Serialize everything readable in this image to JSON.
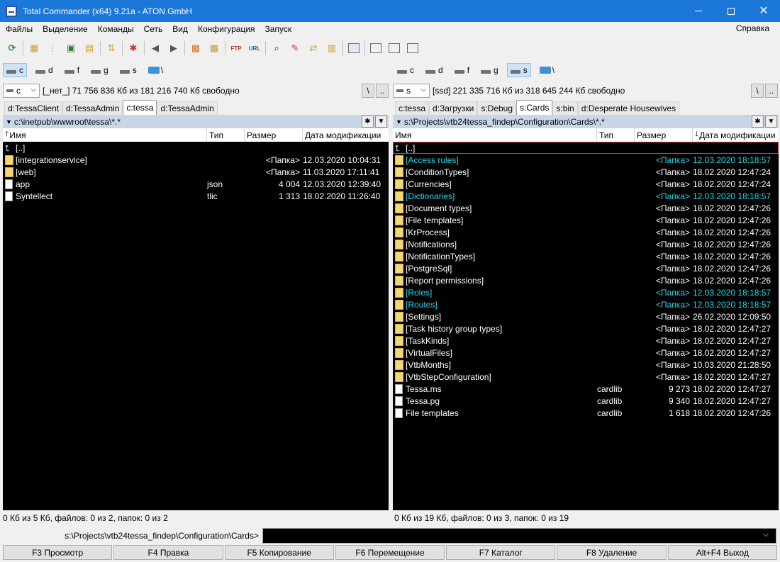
{
  "window": {
    "title": "Total Commander (x64) 9.21a - ATON GmbH"
  },
  "menu": {
    "items": [
      "Файлы",
      "Выделение",
      "Команды",
      "Сеть",
      "Вид",
      "Конфигурация",
      "Запуск"
    ],
    "help": "Справка"
  },
  "left": {
    "drives": [
      "c",
      "d",
      "f",
      "g",
      "s",
      "\\"
    ],
    "active_drive": "c",
    "drive_combo": "c",
    "drive_info": "[_нет_]  71 756 836 Кб из 181 216 740 Кб свободно",
    "root_btn": "\\",
    "up_btn": "..",
    "tabs": [
      "d:TessaClient",
      "d:TessaAdmin",
      "c:tessa",
      "d:TessaAdmin"
    ],
    "active_tab": 2,
    "path": "c:\\inetpub\\wwwroot\\tessa\\*.*",
    "cols": {
      "name": "Имя",
      "ext": "Тип",
      "size": "Размер",
      "date": "Дата модификации"
    },
    "rows": [
      {
        "name": "[..]",
        "ext": "",
        "size": "",
        "date": "",
        "kind": "up"
      },
      {
        "name": "[integrationservice]",
        "ext": "",
        "size": "<Папка>",
        "date": "12.03.2020 10:04:31",
        "kind": "folder"
      },
      {
        "name": "[web]",
        "ext": "",
        "size": "<Папка>",
        "date": "11.03.2020 17:11:41",
        "kind": "folder"
      },
      {
        "name": "app",
        "ext": "json",
        "size": "4 004",
        "date": "12.03.2020 12:39:40",
        "kind": "file"
      },
      {
        "name": "Syntellect",
        "ext": "tlic",
        "size": "1 313",
        "date": "18.02.2020 11:26:40",
        "kind": "file"
      }
    ],
    "status": "0 Кб из 5 Кб, файлов: 0 из 2, папок: 0 из 2"
  },
  "right": {
    "drives": [
      "c",
      "d",
      "f",
      "g",
      "s",
      "\\"
    ],
    "active_drive": "s",
    "drive_combo": "s",
    "drive_info": "[ssd]  221 335 716 Кб из 318 645 244 Кб свободно",
    "root_btn": "\\",
    "up_btn": "..",
    "tabs": [
      "c:tessa",
      "d:Загрузки",
      "s:Debug",
      "s:Cards",
      "s:bin",
      "d:Desperate Housewives"
    ],
    "active_tab": 3,
    "path": "s:\\Projects\\vtb24tessa_findep\\Configuration\\Cards\\*.*",
    "cols": {
      "name": "Имя",
      "ext": "Тип",
      "size": "Размер",
      "date": "Дата модификации"
    },
    "rows": [
      {
        "name": "[..]",
        "ext": "",
        "size": "",
        "date": "",
        "kind": "up",
        "cursor": true
      },
      {
        "name": "[Access rules]",
        "ext": "",
        "size": "<Папка>",
        "date": "12.03.2020 18:18:57",
        "kind": "folder",
        "hl": true
      },
      {
        "name": "[ConditionTypes]",
        "ext": "",
        "size": "<Папка>",
        "date": "18.02.2020 12:47:24",
        "kind": "folder"
      },
      {
        "name": "[Currencies]",
        "ext": "",
        "size": "<Папка>",
        "date": "18.02.2020 12:47:24",
        "kind": "folder"
      },
      {
        "name": "[Dictionaries]",
        "ext": "",
        "size": "<Папка>",
        "date": "12.03.2020 18:18:57",
        "kind": "folder",
        "hl": true
      },
      {
        "name": "[Document types]",
        "ext": "",
        "size": "<Папка>",
        "date": "18.02.2020 12:47:26",
        "kind": "folder"
      },
      {
        "name": "[File templates]",
        "ext": "",
        "size": "<Папка>",
        "date": "18.02.2020 12:47:26",
        "kind": "folder"
      },
      {
        "name": "[KrProcess]",
        "ext": "",
        "size": "<Папка>",
        "date": "18.02.2020 12:47:26",
        "kind": "folder"
      },
      {
        "name": "[Notifications]",
        "ext": "",
        "size": "<Папка>",
        "date": "18.02.2020 12:47:26",
        "kind": "folder"
      },
      {
        "name": "[NotificationTypes]",
        "ext": "",
        "size": "<Папка>",
        "date": "18.02.2020 12:47:26",
        "kind": "folder"
      },
      {
        "name": "[PostgreSql]",
        "ext": "",
        "size": "<Папка>",
        "date": "18.02.2020 12:47:26",
        "kind": "folder"
      },
      {
        "name": "[Report permissions]",
        "ext": "",
        "size": "<Папка>",
        "date": "18.02.2020 12:47:26",
        "kind": "folder"
      },
      {
        "name": "[Roles]",
        "ext": "",
        "size": "<Папка>",
        "date": "12.03.2020 18:18:57",
        "kind": "folder",
        "hl": true
      },
      {
        "name": "[Routes]",
        "ext": "",
        "size": "<Папка>",
        "date": "12.03.2020 18:18:57",
        "kind": "folder",
        "hl": true
      },
      {
        "name": "[Settings]",
        "ext": "",
        "size": "<Папка>",
        "date": "26.02.2020 12:09:50",
        "kind": "folder"
      },
      {
        "name": "[Task history group types]",
        "ext": "",
        "size": "<Папка>",
        "date": "18.02.2020 12:47:27",
        "kind": "folder"
      },
      {
        "name": "[TaskKinds]",
        "ext": "",
        "size": "<Папка>",
        "date": "18.02.2020 12:47:27",
        "kind": "folder"
      },
      {
        "name": "[VirtualFiles]",
        "ext": "",
        "size": "<Папка>",
        "date": "18.02.2020 12:47:27",
        "kind": "folder"
      },
      {
        "name": "[VtbMonths]",
        "ext": "",
        "size": "<Папка>",
        "date": "10.03.2020 21:28:50",
        "kind": "folder"
      },
      {
        "name": "[VtbStepConfiguration]",
        "ext": "",
        "size": "<Папка>",
        "date": "18.02.2020 12:47:27",
        "kind": "folder"
      },
      {
        "name": "Tessa.ms",
        "ext": "cardlib",
        "size": "9 273",
        "date": "18.02.2020 12:47:27",
        "kind": "file"
      },
      {
        "name": "Tessa.pg",
        "ext": "cardlib",
        "size": "9 340",
        "date": "18.02.2020 12:47:27",
        "kind": "file"
      },
      {
        "name": "File templates",
        "ext": "cardlib",
        "size": "1 618",
        "date": "18.02.2020 12:47:26",
        "kind": "file"
      }
    ],
    "status": "0 Кб из 19 Кб, файлов: 0 из 3, папок: 0 из 19"
  },
  "cmdline": {
    "prompt": "s:\\Projects\\vtb24tessa_findep\\Configuration\\Cards>"
  },
  "fkeys": [
    "F3 Просмотр",
    "F4 Правка",
    "F5 Копирование",
    "F6 Перемещение",
    "F7 Каталог",
    "F8 Удаление",
    "Alt+F4 Выход"
  ]
}
